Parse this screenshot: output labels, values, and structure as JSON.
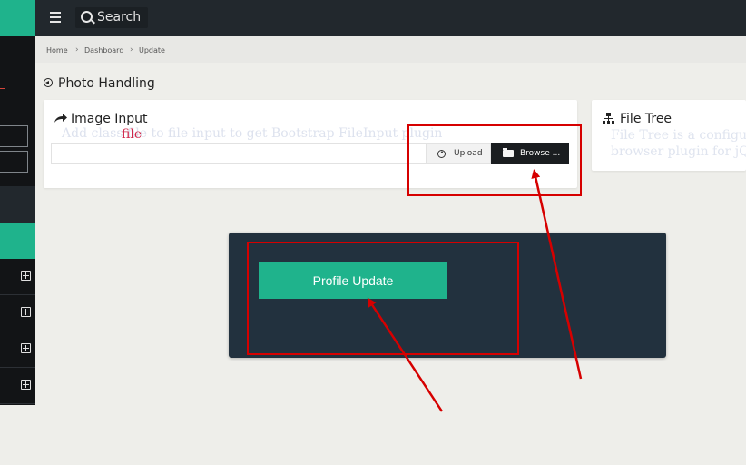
{
  "topbar": {
    "search_label": "Search"
  },
  "breadcrumb": {
    "home": "Home",
    "dashboard": "Dashboard",
    "current": "Update",
    "sep": "›"
  },
  "section": {
    "title": "Photo Handling"
  },
  "image_input": {
    "title": "Image Input",
    "faded_text": "Add class file to file input to get Bootstrap FileInput plugin",
    "file_word": "file",
    "upload_label": "Upload",
    "browse_label": "Browse ..."
  },
  "file_tree": {
    "title": "File Tree",
    "faded_line1": "File Tree is a configurable",
    "faded_line2": "browser plugin for jQuery"
  },
  "profile": {
    "button_label": "Profile Update"
  },
  "colors": {
    "topbar": "#22282d",
    "accent": "#1fb38c",
    "sidebar": "#121416",
    "dark_panel": "#22313e",
    "annotation": "#d60000"
  }
}
